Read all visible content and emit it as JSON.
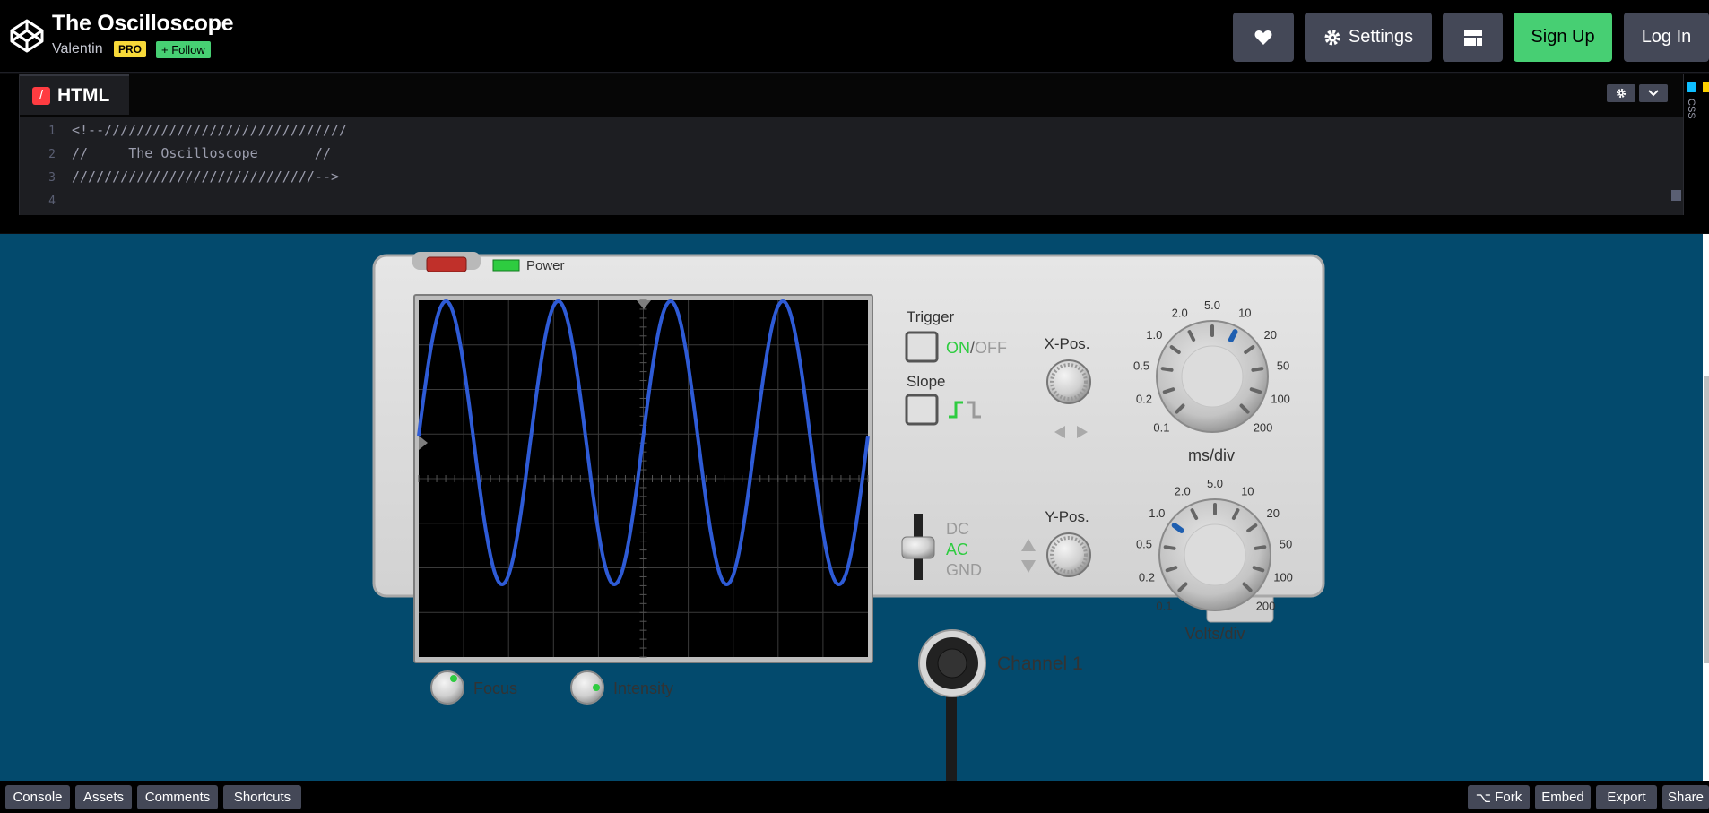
{
  "header": {
    "title": "The Oscilloscope",
    "author": "Valentin",
    "pro_badge": "PRO",
    "follow_label": "Follow",
    "settings_label": "Settings",
    "signup_label": "Sign Up",
    "login_label": "Log In"
  },
  "editor": {
    "tab_label": "HTML",
    "tab_icon": "/",
    "side_label": "CSS",
    "lines": [
      {
        "n": "1",
        "text": "<!--//////////////////////////////"
      },
      {
        "n": "2",
        "text": "//     The Oscilloscope       //"
      },
      {
        "n": "3",
        "text": "//////////////////////////////-->"
      },
      {
        "n": "4",
        "text": ""
      }
    ]
  },
  "scope": {
    "power_label": "Power",
    "trigger_label": "Trigger",
    "trigger_on": "ON",
    "trigger_sep": "/",
    "trigger_off": "OFF",
    "slope_label": "Slope",
    "xpos_label": "X-Pos.",
    "ypos_label": "Y-Pos.",
    "coupling": [
      "DC",
      "AC",
      "GND"
    ],
    "coupling_selected": "AC",
    "time_dial": {
      "unit": "ms/div",
      "scale": [
        "0.1",
        "0.2",
        "0.5",
        "1.0",
        "2.0",
        "5.0",
        "10",
        "20",
        "50",
        "100",
        "200"
      ],
      "selected": "10"
    },
    "volt_dial": {
      "unit": "Volts/div",
      "scale": [
        "0.1",
        "0.2",
        "0.5",
        "1.0",
        "2.0",
        "5.0",
        "10",
        "20",
        "50",
        "100",
        "200"
      ],
      "selected": "1.0"
    },
    "focus_label": "Focus",
    "intensity_label": "Intensity",
    "channel_label": "Channel 1",
    "waveform": {
      "type": "sine",
      "cycles": 4
    },
    "colors": {
      "trace": "#2e5bd6",
      "on": "#2ecc40",
      "off": "#9a9a9a",
      "body": "#dcdcdc",
      "background": "#034a6d"
    }
  },
  "bottombar": {
    "left": [
      "Console",
      "Assets",
      "Comments",
      "Shortcuts"
    ],
    "right": [
      "Fork",
      "Embed",
      "Export",
      "Share"
    ]
  }
}
